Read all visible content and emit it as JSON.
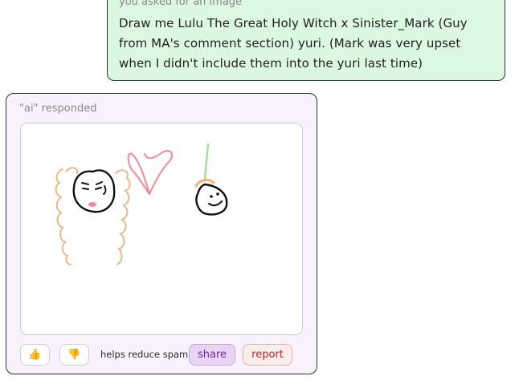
{
  "user_message": {
    "caption": "you asked for an image",
    "prompt": "Draw me Lulu The Great Holy Witch x Sinister_Mark (Guy from MA's comment section) yuri. (Mark was very upset when I didn't include them into the yuri last time)"
  },
  "ai_response": {
    "caption": "\"ai\" responded",
    "image": {
      "icon": "hand-drawn-sketch",
      "description_elements": [
        "witch-face",
        "heart",
        "onion-face"
      ]
    }
  },
  "actions": {
    "thumbs_up_icon": "👍",
    "thumbs_down_icon": "👎",
    "helps_text": "helps reduce spam",
    "share_label": "share",
    "report_label": "report"
  },
  "colors": {
    "user_bubble_bg": "#dcf8e1",
    "ai_card_bg": "#f7f2fb",
    "share_bg": "#e9d4f5",
    "share_text": "#6a2a97",
    "report_bg": "#fdeeee",
    "report_text": "#c41f1f",
    "thumb_icon": "#e8a317"
  }
}
